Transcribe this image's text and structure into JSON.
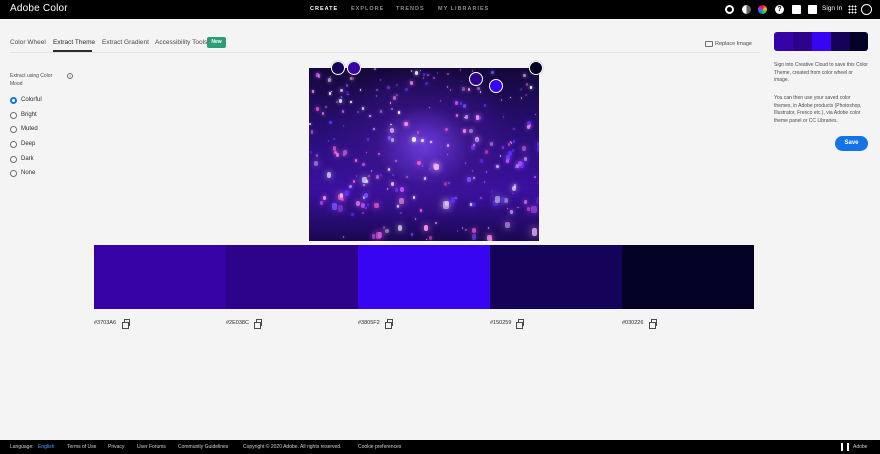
{
  "app": {
    "title": "Adobe Color"
  },
  "topnav": {
    "items": [
      {
        "label": "CREATE",
        "active": true
      },
      {
        "label": "EXPLORE",
        "active": false
      },
      {
        "label": "TRENDS",
        "active": false
      },
      {
        "label": "MY LIBRARIES",
        "active": false
      }
    ],
    "icons": [
      "settings-icon",
      "contrast-icon",
      "color-wheel-icon",
      "help-icon",
      "feedback-icon",
      "chat-icon"
    ],
    "sign_in": "Sign In"
  },
  "tabs": [
    {
      "label": "Color Wheel",
      "active": false
    },
    {
      "label": "Extract Theme",
      "active": true
    },
    {
      "label": "Extract Gradient",
      "active": false
    },
    {
      "label": "Accessibility Tools",
      "active": false
    }
  ],
  "badge": "New",
  "replace_image": "Replace Image",
  "mood": {
    "title": "Extract using Color Mood",
    "options": [
      {
        "label": "Colorful",
        "checked": true
      },
      {
        "label": "Bright",
        "checked": false
      },
      {
        "label": "Muted",
        "checked": false
      },
      {
        "label": "Deep",
        "checked": false
      },
      {
        "label": "Dark",
        "checked": false
      },
      {
        "label": "None",
        "checked": false
      }
    ]
  },
  "theme": {
    "swatches": [
      {
        "hex": "#3703A6",
        "color": "#3703A6"
      },
      {
        "hex": "#2E038C",
        "color": "#2E038C"
      },
      {
        "hex": "#3805F2",
        "color": "#3805F2"
      },
      {
        "hex": "#150259",
        "color": "#150259"
      },
      {
        "hex": "#030226",
        "color": "#030226"
      }
    ]
  },
  "right_panel": {
    "sign_in_text": "Sign into Creative Cloud to save this Color Theme, created from color wheel or image.",
    "info_text": "You can then use your saved color themes, in Adobe products (Photoshop, Illustrator, Fresco etc.), via Adobe color theme panel or CC Libraries.",
    "save_label": "Save"
  },
  "footer": {
    "language_label": "Language:",
    "language_value": "English",
    "links": [
      "Terms of Use",
      "Privacy",
      "User Forums",
      "Community Guidelines"
    ],
    "copyright": "Copyright © 2020 Adobe. All rights reserved.",
    "cookie": "Cookie preferences",
    "brand": "Adobe"
  }
}
